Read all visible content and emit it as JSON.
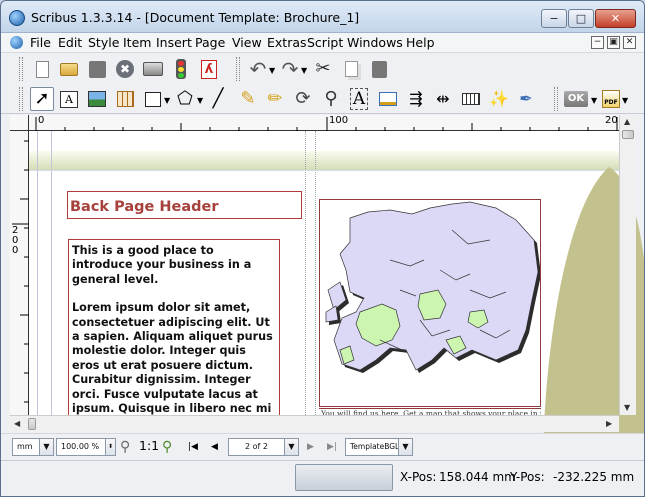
{
  "window": {
    "title": "Scribus 1.3.3.14 - [Document Template: Brochure_1]",
    "minimize": "−",
    "maximize": "□",
    "close": "✕"
  },
  "menu": [
    "File",
    "Edit",
    "Style",
    "Item",
    "Insert",
    "Page",
    "View",
    "Extras",
    "Script",
    "Windows",
    "Help"
  ],
  "mdi_controls": [
    "−",
    "▣",
    "✕"
  ],
  "toolbar1": [
    {
      "name": "new-document",
      "icon": "new-doc-icon",
      "glyph": "🗋"
    },
    {
      "name": "open",
      "icon": "folder-icon",
      "glyph": "📂"
    },
    {
      "name": "save",
      "icon": "save-icon",
      "glyph": "■"
    },
    {
      "name": "close",
      "icon": "close-doc-icon",
      "glyph": "✖"
    },
    {
      "name": "print",
      "icon": "printer-icon",
      "glyph": "🖨"
    },
    {
      "name": "preflight",
      "icon": "traffic-light-icon",
      "glyph": "☷"
    },
    {
      "name": "export-pdf",
      "icon": "pdf-icon",
      "glyph": "✐"
    },
    {
      "name": "undo",
      "icon": "undo-icon",
      "glyph": "↶"
    },
    {
      "name": "redo",
      "icon": "redo-icon",
      "glyph": "↷"
    },
    {
      "name": "cut",
      "icon": "scissors-icon",
      "glyph": "✂"
    },
    {
      "name": "copy",
      "icon": "copy-icon",
      "glyph": "❐"
    },
    {
      "name": "paste",
      "icon": "paste-icon",
      "glyph": "⎘"
    }
  ],
  "toolbar2": [
    {
      "name": "select",
      "icon": "pointer-icon",
      "glyph": "↖"
    },
    {
      "name": "text-frame",
      "icon": "text-frame-icon",
      "glyph": "A"
    },
    {
      "name": "image-frame",
      "icon": "image-frame-icon",
      "glyph": "▣"
    },
    {
      "name": "table",
      "icon": "table-icon",
      "glyph": "⊞"
    },
    {
      "name": "shape",
      "icon": "rectangle-icon",
      "glyph": "□"
    },
    {
      "name": "polygon",
      "icon": "pentagon-icon",
      "glyph": "⬠"
    },
    {
      "name": "line",
      "icon": "line-icon",
      "glyph": "╱"
    },
    {
      "name": "bezier",
      "icon": "bezier-icon",
      "glyph": "✎"
    },
    {
      "name": "freehand",
      "icon": "pencil-icon",
      "glyph": "✏"
    },
    {
      "name": "rotate",
      "icon": "rotate-icon",
      "glyph": "↻"
    },
    {
      "name": "zoom",
      "icon": "magnifier-icon",
      "glyph": "⚲"
    },
    {
      "name": "edit-text",
      "icon": "edit-text-icon",
      "glyph": "A"
    },
    {
      "name": "story-editor",
      "icon": "story-editor-icon",
      "glyph": "✍"
    },
    {
      "name": "link-frames",
      "icon": "link-frames-icon",
      "glyph": "⇶"
    },
    {
      "name": "unlink-frames",
      "icon": "unlink-frames-icon",
      "glyph": "⇹"
    },
    {
      "name": "measure",
      "icon": "ruler-icon",
      "glyph": "┅"
    },
    {
      "name": "copy-properties",
      "icon": "wand-icon",
      "glyph": "✨"
    },
    {
      "name": "eyedropper",
      "icon": "eyedropper-icon",
      "glyph": "✐"
    },
    {
      "name": "ok",
      "icon": "ok-icon",
      "glyph": "OK"
    },
    {
      "name": "pdf-tools",
      "icon": "pdf-icon",
      "glyph": "PDF"
    }
  ],
  "ruler": {
    "h_labels": [
      "0",
      "100",
      "20"
    ],
    "v_label": "200"
  },
  "document": {
    "header": "Back Page Header",
    "intro": "This is a good place to introduce your business in a general level.",
    "body": "Lorem ipsum dolor sit amet, consectetuer adipiscing elit. Ut a sapien. Aliquam aliquet purus molestie dolor. Integer quis eros ut erat posuere dictum. Curabitur dignissim. Integer orci. Fusce vulputate lacus at ipsum. Quisque in libero nec mi laoreet volutpat. Aliquam eros pede.",
    "caption": "You will find us here. Get a map that shows your place in to"
  },
  "colors": {
    "header_text": "#a6413c",
    "frame_border": "#b23a3a",
    "leaf": "#c3c28e",
    "map_land": "#dcd9f7",
    "map_highlight": "#ccf5b0"
  },
  "status": {
    "unit": "mm",
    "zoom": "100.00 %",
    "zoom_reset": "1:1",
    "page": "2 of 2",
    "layer": "TemplateBGL",
    "xpos_label": "X-Pos:",
    "xpos": "158.044 mm",
    "ypos_label": "Y-Pos:",
    "ypos": "-232.225 mm"
  }
}
